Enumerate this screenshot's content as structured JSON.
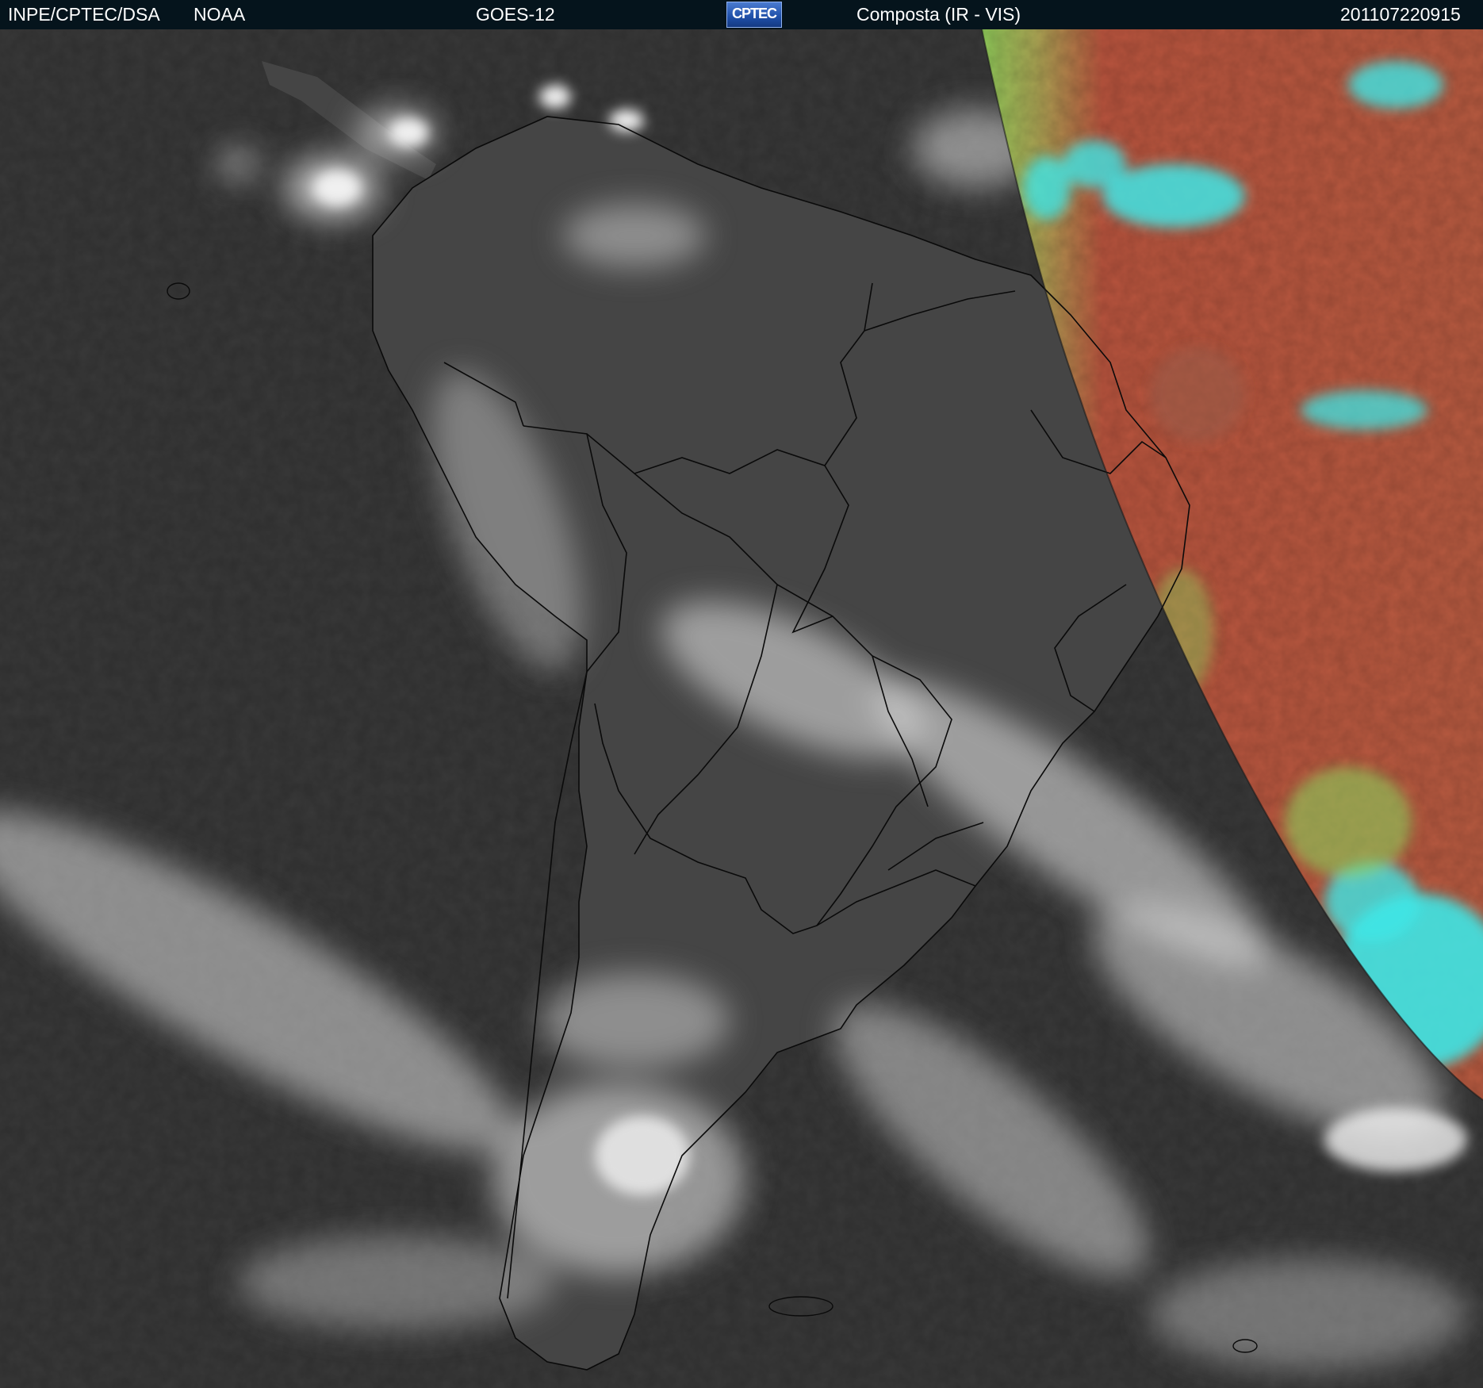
{
  "header": {
    "agency": "INPE/CPTEC/DSA",
    "source": "NOAA",
    "satellite": "GOES-12",
    "logo_text": "CPTEC",
    "product": "Composta (IR - VIS)",
    "timestamp": "201107220915"
  },
  "colors": {
    "header_bg": "#05141c",
    "ir_ocean": "#3a3a3a",
    "ir_land": "#4a4a4a",
    "cloud": "#d8d8d8",
    "vis_land": "#b8543e",
    "vis_coast_green": "#8ccf5a",
    "vis_cloud_cyan": "#3fe6e6",
    "border_line": "#0a0a0a"
  },
  "map": {
    "region": "South America",
    "projection_view": "satellite full disk sector",
    "terminator": "day/night boundary — visible channel on east side"
  }
}
